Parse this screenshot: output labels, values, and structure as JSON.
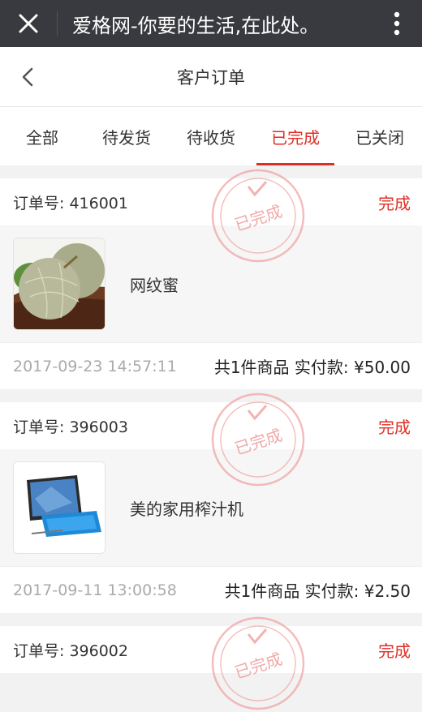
{
  "wechat_bar": {
    "title": "爱格网-你要的生活,在此处。"
  },
  "header": {
    "title": "客户订单"
  },
  "tabs": [
    {
      "label": "全部",
      "active": false
    },
    {
      "label": "待发货",
      "active": false
    },
    {
      "label": "待收货",
      "active": false
    },
    {
      "label": "已完成",
      "active": true
    },
    {
      "label": "已关闭",
      "active": false
    }
  ],
  "stamp_text": "已完成",
  "orders": [
    {
      "order_no": "订单号: 416001",
      "status": "完成",
      "goods_name": "网纹蜜",
      "thumb": "melon-image",
      "time": "2017-09-23 14:57:11",
      "total": "共1件商品 实付款: ¥50.00"
    },
    {
      "order_no": "订单号: 396003",
      "status": "完成",
      "goods_name": "美的家用榨汁机",
      "thumb": "tablet-image",
      "time": "2017-09-11 13:00:58",
      "total": "共1件商品 实付款: ¥2.50"
    },
    {
      "order_no": "订单号: 396002",
      "status": "完成"
    }
  ],
  "colors": {
    "accent": "#e02e24",
    "topbar": "#393a3f",
    "stamp": "#f0a0a0"
  }
}
